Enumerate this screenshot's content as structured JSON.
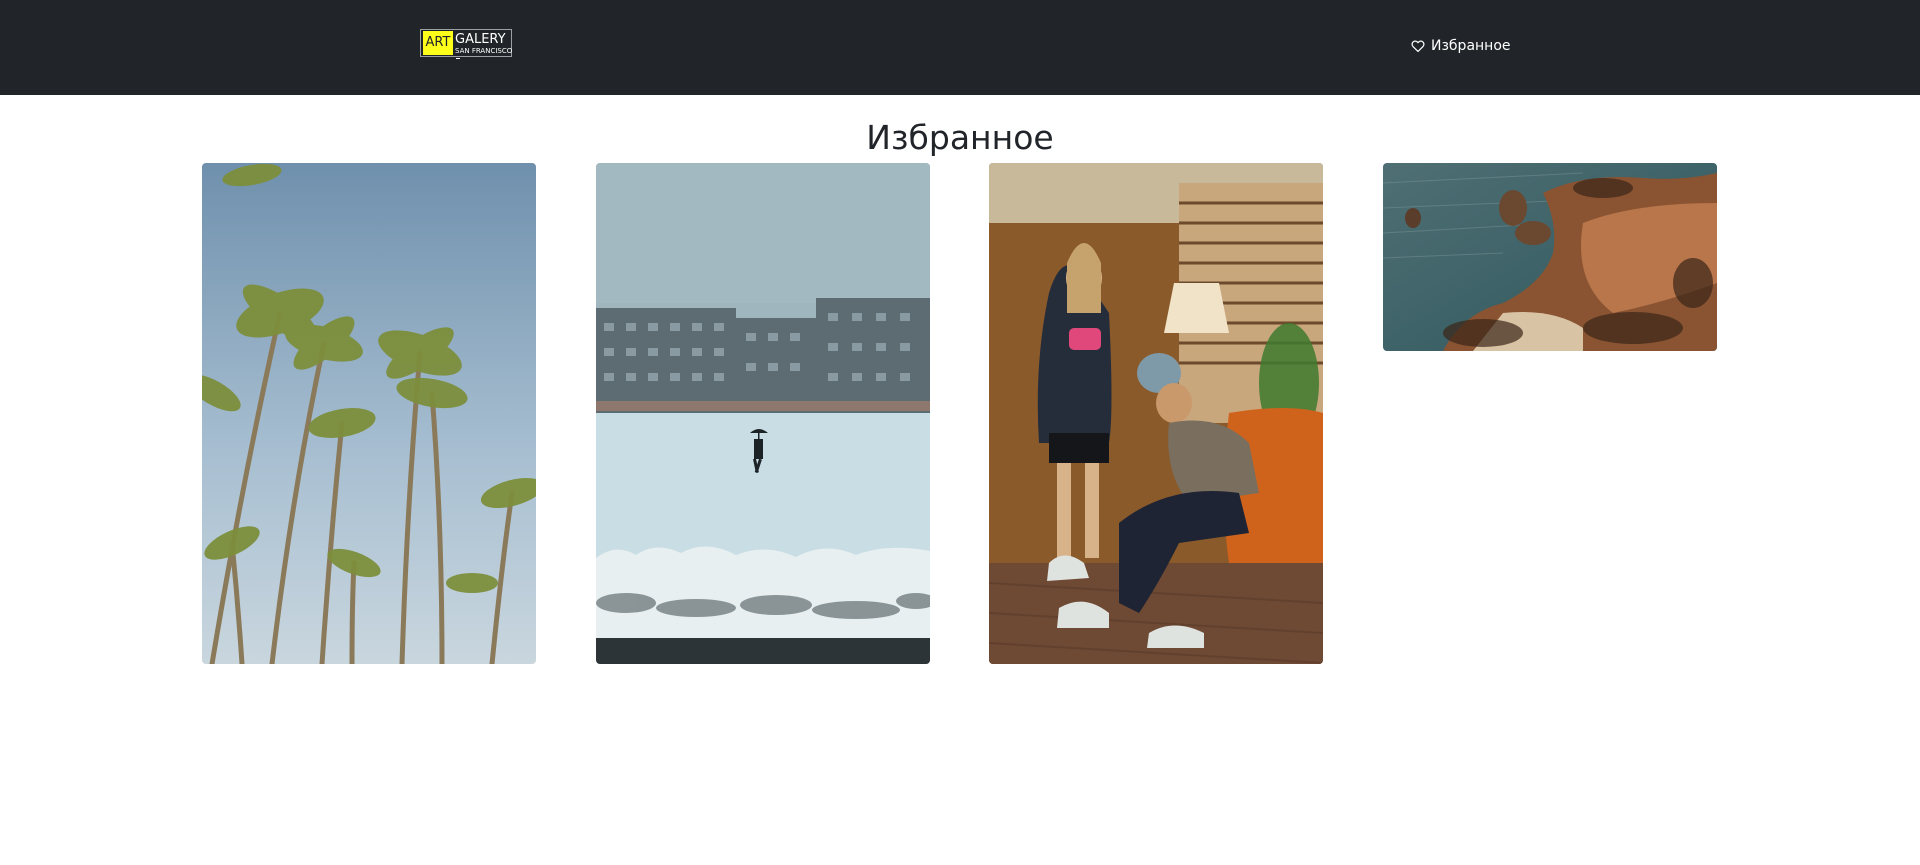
{
  "navbar": {
    "logo": {
      "art": "ART",
      "galery": "GALERY",
      "subtitle": "SAN FRANCISCO"
    },
    "favorites_link": {
      "label": "Избранное",
      "icon": "heart-outline-icon"
    }
  },
  "main": {
    "title": "Избранное",
    "gallery": [
      {
        "subject": "palm-trees",
        "icon": "photo"
      },
      {
        "subject": "snowy-field-person-umbrella",
        "icon": "photo"
      },
      {
        "subject": "two-people-sneakers-interior",
        "icon": "photo"
      },
      {
        "subject": "rocky-coast-sea",
        "icon": "photo"
      }
    ]
  },
  "colors": {
    "navbar_bg": "#212529",
    "logo_accent": "#ffff1a",
    "page_bg": "#ffffff",
    "text": "#212529"
  }
}
